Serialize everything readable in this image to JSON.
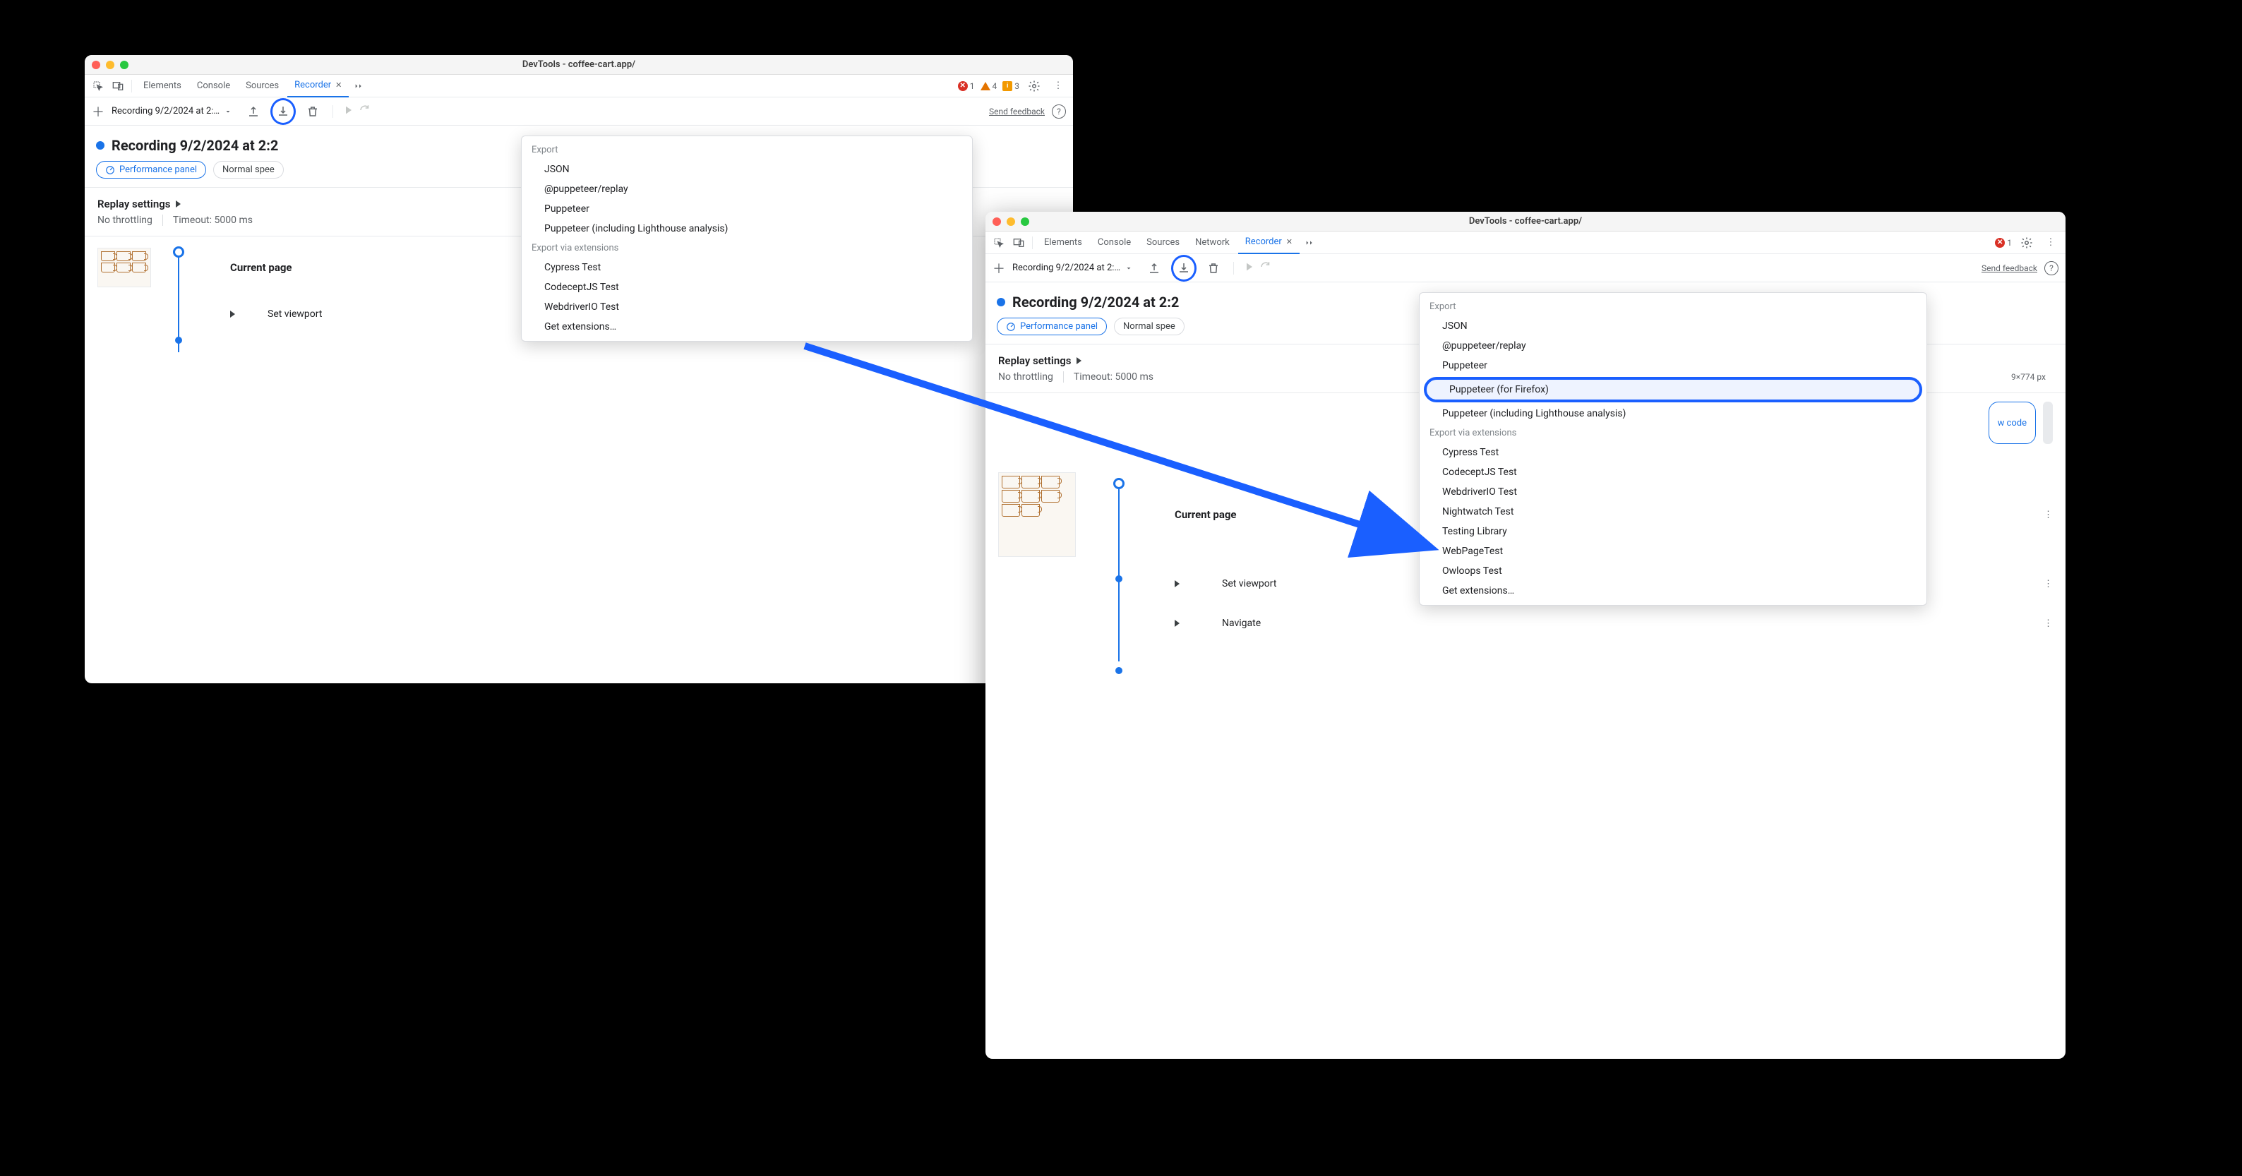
{
  "window1": {
    "title": "DevTools - coffee-cart.app/",
    "tabs": [
      "Elements",
      "Console",
      "Sources",
      "Recorder"
    ],
    "active_tab": "Recorder",
    "status": {
      "errors": "1",
      "warnings": "4",
      "info": "3"
    },
    "recording_select": "Recording 9/2/2024 at 2:…",
    "send_feedback": "Send feedback",
    "rec_title": "Recording 9/2/2024 at 2:2",
    "perf_panel": "Performance panel",
    "speed_select": "Normal spee",
    "replay_hdr": "Replay settings",
    "throttling": "No throttling",
    "timeout": "Timeout: 5000 ms",
    "steps": {
      "current_page": "Current page",
      "set_viewport": "Set viewport"
    },
    "menu": {
      "export_hdr": "Export",
      "items_native": [
        "JSON",
        "@puppeteer/replay",
        "Puppeteer",
        "Puppeteer (including Lighthouse analysis)"
      ],
      "ext_hdr": "Export via extensions",
      "items_ext": [
        "Cypress Test",
        "CodeceptJS Test",
        "WebdriverIO Test",
        "Get extensions…"
      ]
    }
  },
  "window2": {
    "title": "DevTools - coffee-cart.app/",
    "tabs": [
      "Elements",
      "Console",
      "Sources",
      "Network",
      "Recorder"
    ],
    "active_tab": "Recorder",
    "status": {
      "errors": "1"
    },
    "recording_select": "Recording 9/2/2024 at 2:…",
    "send_feedback": "Send feedback",
    "rec_title": "Recording 9/2/2024 at 2:2",
    "perf_panel": "Performance panel",
    "speed_select": "Normal spee",
    "replay_hdr": "Replay settings",
    "throttling": "No throttling",
    "timeout": "Timeout: 5000 ms",
    "pixel_badge": "9×774 px",
    "show_code": "w code",
    "steps": {
      "current_page": "Current page",
      "set_viewport": "Set viewport",
      "navigate": "Navigate"
    },
    "menu": {
      "export_hdr": "Export",
      "items_native": [
        "JSON",
        "@puppeteer/replay",
        "Puppeteer",
        "Puppeteer (for Firefox)",
        "Puppeteer (including Lighthouse analysis)"
      ],
      "highlight_index": 3,
      "ext_hdr": "Export via extensions",
      "items_ext": [
        "Cypress Test",
        "CodeceptJS Test",
        "WebdriverIO Test",
        "Nightwatch Test",
        "Testing Library",
        "WebPageTest",
        "Owloops Test",
        "Get extensions…"
      ]
    }
  }
}
